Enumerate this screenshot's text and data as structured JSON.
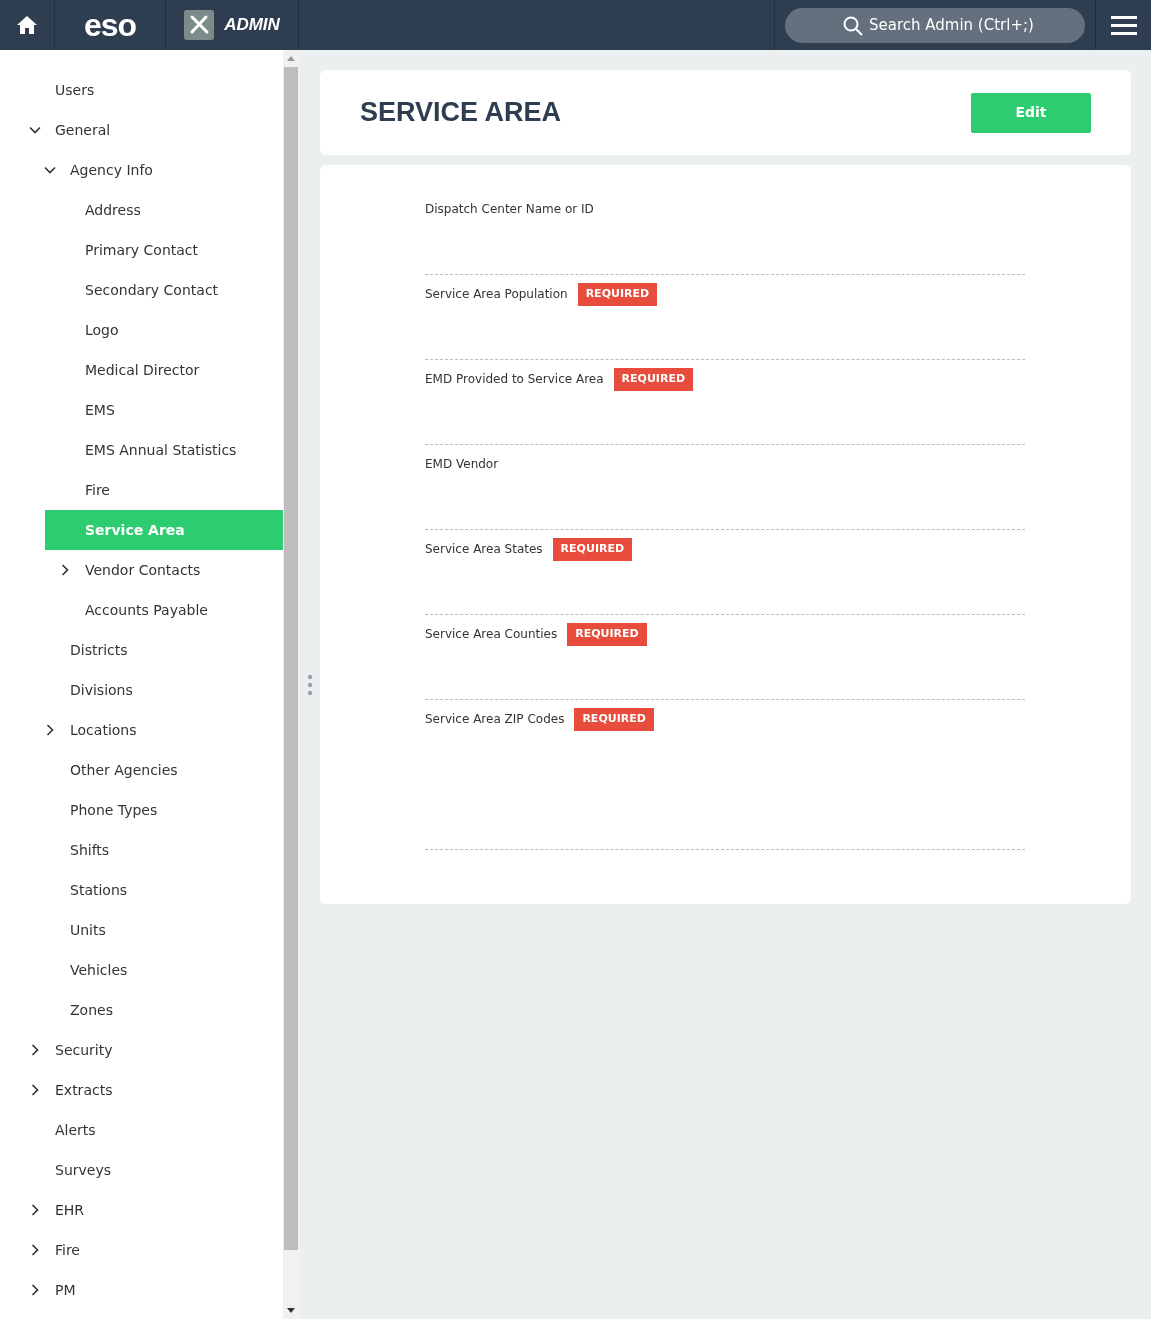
{
  "header": {
    "logo": "eso",
    "app": "ADMIN",
    "search": {
      "placeholder": "Search Admin (Ctrl+;)"
    }
  },
  "sidebar": {
    "items": [
      {
        "label": "Users",
        "selected": false
      },
      {
        "label": "General",
        "selected": false,
        "expanded": true,
        "children": [
          {
            "label": "Agency Info",
            "selected": false,
            "expanded": true,
            "children": [
              {
                "label": "Address",
                "selected": false
              },
              {
                "label": "Primary Contact",
                "selected": false
              },
              {
                "label": "Secondary Contact",
                "selected": false
              },
              {
                "label": "Logo",
                "selected": false
              },
              {
                "label": "Medical Director",
                "selected": false
              },
              {
                "label": "EMS",
                "selected": false
              },
              {
                "label": "EMS Annual Statistics",
                "selected": false
              },
              {
                "label": "Fire",
                "selected": false
              },
              {
                "label": "Service Area",
                "selected": true
              },
              {
                "label": "Vendor Contacts",
                "selected": false,
                "expanded": false
              },
              {
                "label": "Accounts Payable",
                "selected": false
              }
            ]
          },
          {
            "label": "Districts",
            "selected": false
          },
          {
            "label": "Divisions",
            "selected": false
          },
          {
            "label": "Locations",
            "selected": false,
            "expanded": false
          },
          {
            "label": "Other Agencies",
            "selected": false
          },
          {
            "label": "Phone Types",
            "selected": false
          },
          {
            "label": "Shifts",
            "selected": false
          },
          {
            "label": "Stations",
            "selected": false
          },
          {
            "label": "Units",
            "selected": false
          },
          {
            "label": "Vehicles",
            "selected": false
          },
          {
            "label": "Zones",
            "selected": false
          }
        ]
      },
      {
        "label": "Security",
        "selected": false,
        "expanded": false
      },
      {
        "label": "Extracts",
        "selected": false,
        "expanded": false
      },
      {
        "label": "Alerts",
        "selected": false
      },
      {
        "label": "Surveys",
        "selected": false
      },
      {
        "label": "EHR",
        "selected": false,
        "expanded": false
      },
      {
        "label": "Fire",
        "selected": false,
        "expanded": false
      },
      {
        "label": "PM",
        "selected": false,
        "expanded": false
      }
    ]
  },
  "page": {
    "title": "SERVICE AREA",
    "edit_button": "Edit",
    "fields": [
      {
        "label": "Dispatch Center Name or ID"
      },
      {
        "label": "Service Area Population",
        "badge": "REQUIRED"
      },
      {
        "label": "EMD Provided to Service Area",
        "badge": "REQUIRED"
      },
      {
        "label": "EMD Vendor"
      },
      {
        "label": "Service Area States",
        "badge": "REQUIRED"
      },
      {
        "label": "Service Area Counties",
        "badge": "REQUIRED"
      },
      {
        "label": "Service Area ZIP Codes",
        "badge": "REQUIRED",
        "tall": true
      }
    ]
  }
}
